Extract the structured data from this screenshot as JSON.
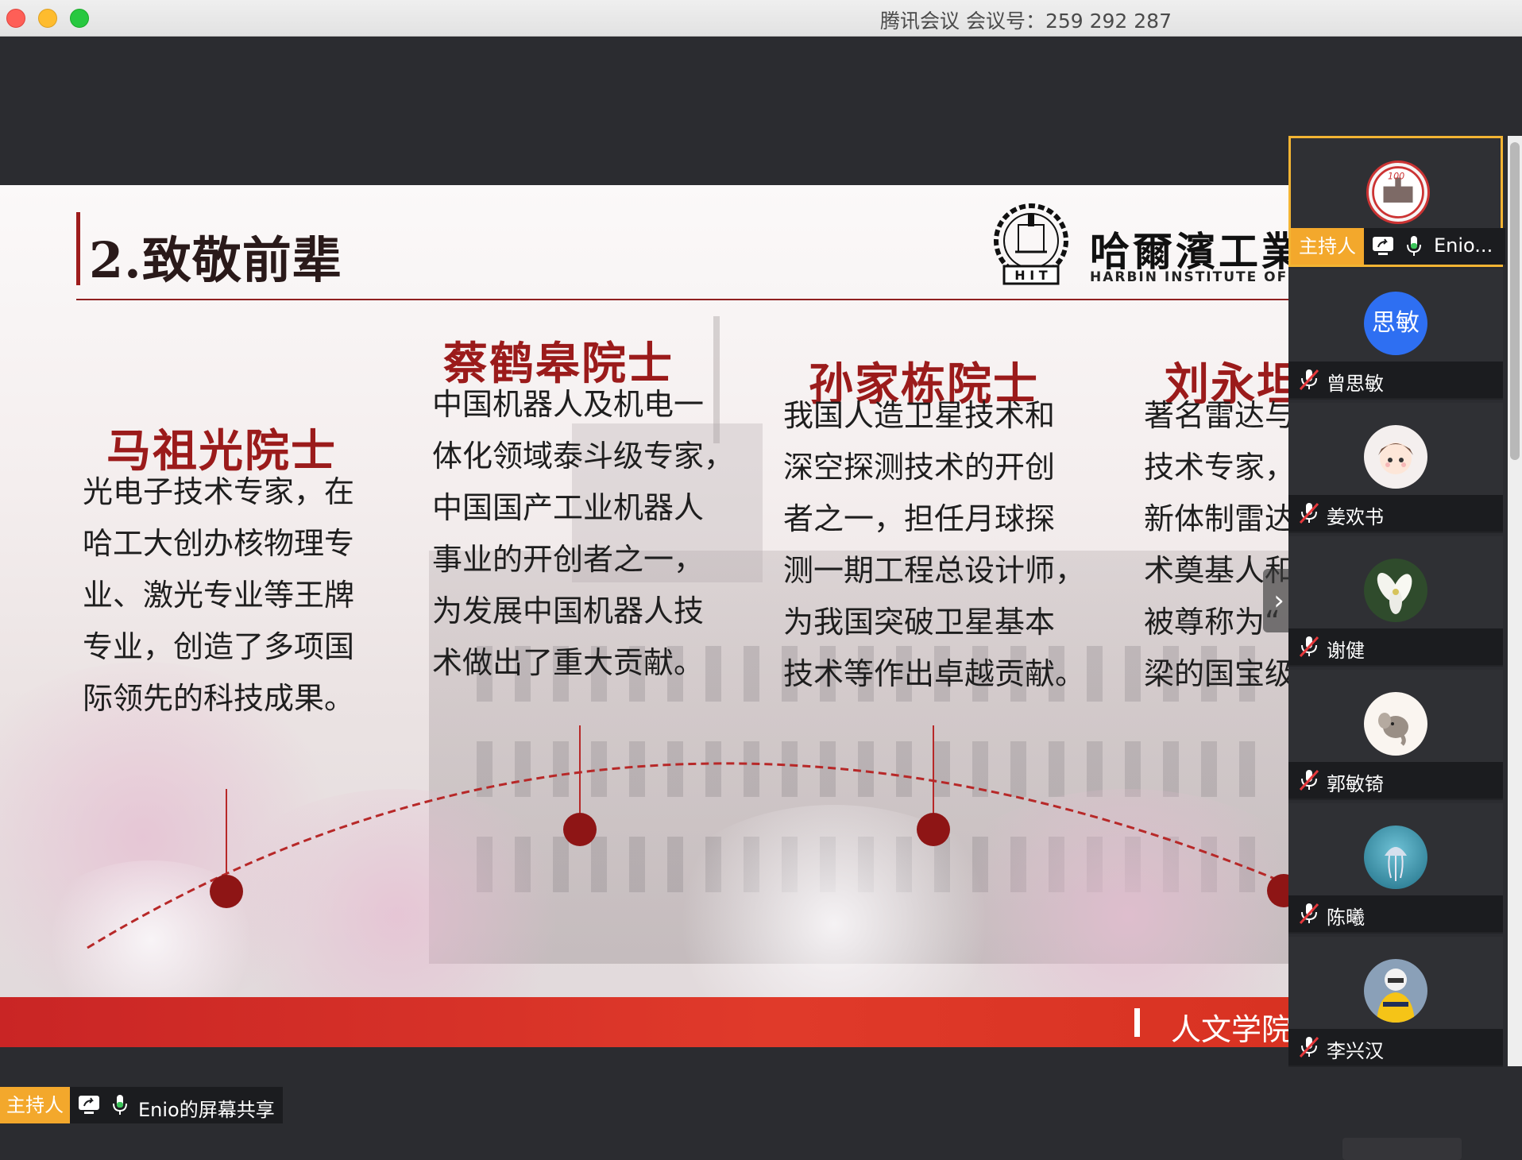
{
  "window": {
    "title": "腾讯会议 会议号：259 292 287"
  },
  "slide": {
    "title": "2.致敬前辈",
    "logo_cn": "哈爾濱工業大",
    "logo_en": "HARBIN INSTITUTE OF TEC",
    "footer": "人文学院",
    "people": [
      {
        "name": "马祖光院士",
        "lines": [
          "光电子技术专家，在",
          "哈工大创办核物理专",
          "业、激光专业等王牌",
          "专业，创造了多项国",
          "际领先的科技成果。"
        ]
      },
      {
        "name": "蔡鹤皋院士",
        "lines": [
          "中国机器人及机电一",
          "体化领域泰斗级专家，",
          "中国国产工业机器人",
          "事业的开创者之一，",
          "为发展中国机器人技",
          "术做出了重大贡献。"
        ]
      },
      {
        "name": "孙家栋院士",
        "lines": [
          "我国人造卫星技术和",
          "深空探测技术的开创",
          "者之一，担任月球探",
          "测一期工程总设计师，",
          "为我国突破卫星基本",
          "技术等作出卓越贡献。"
        ]
      },
      {
        "name": "刘永坦",
        "lines": [
          "著名雷达与",
          "技术专家，",
          "新体制雷达",
          "术奠基人和",
          "被尊称为“",
          "梁的国宝级"
        ]
      }
    ]
  },
  "participants": [
    {
      "name": "Enio...",
      "badge": "主持人",
      "host": true,
      "avatar": "hit-logo-avatar"
    },
    {
      "name": "曾思敏",
      "avatar_text": "思敏",
      "avatar_color": "#2e6ff2",
      "muted": true
    },
    {
      "name": "姜欢书",
      "avatar": "cartoon-girl-avatar",
      "muted": true
    },
    {
      "name": "谢健",
      "avatar": "lily-flower-avatar",
      "muted": true
    },
    {
      "name": "郭敏锜",
      "avatar": "cartoon-elephant-avatar",
      "muted": true
    },
    {
      "name": "陈曦",
      "avatar": "jellyfish-avatar",
      "muted": true
    },
    {
      "name": "李兴汉",
      "avatar": "hockey-player-avatar",
      "muted": true
    }
  ],
  "share_bar": {
    "badge": "主持人",
    "text": "Enio的屏幕共享"
  },
  "colors": {
    "accent_red": "#9b1b1b",
    "host_badge": "#f3a82c",
    "footer_red": "#d83222"
  }
}
